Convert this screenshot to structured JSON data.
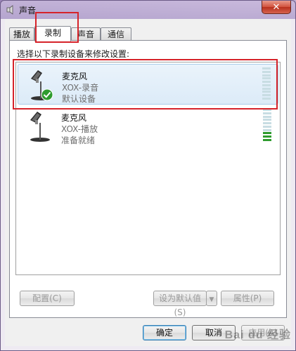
{
  "window": {
    "title": "声音",
    "close_symbol": "✕"
  },
  "tabs": [
    {
      "label": "播放"
    },
    {
      "label": "录制",
      "active": true
    },
    {
      "label": "声音"
    },
    {
      "label": "通信"
    }
  ],
  "recording": {
    "instruction": "选择以下录制设备来修改设置:",
    "devices": [
      {
        "name": "麦克风",
        "subtitle": "XOX-录音",
        "status": "默认设备",
        "icon": "microphone-icon",
        "badge": "default-check-icon",
        "selected": true,
        "level": 0
      },
      {
        "name": "麦克风",
        "subtitle": "XOX-播放",
        "status": "准备就绪",
        "icon": "microphone-icon",
        "selected": false,
        "level": 0.3
      }
    ]
  },
  "buttons": {
    "configure": "配置(C)",
    "set_default": "设为默认值(S)",
    "properties": "属性(P)",
    "ok": "确定",
    "cancel": "取消",
    "apply": "应用(A)"
  },
  "watermark": "Bai du 经验",
  "colors": {
    "highlight": "#d6232a",
    "meter_active": "#2e9b2e",
    "meter_idle": "#c8dde3"
  }
}
